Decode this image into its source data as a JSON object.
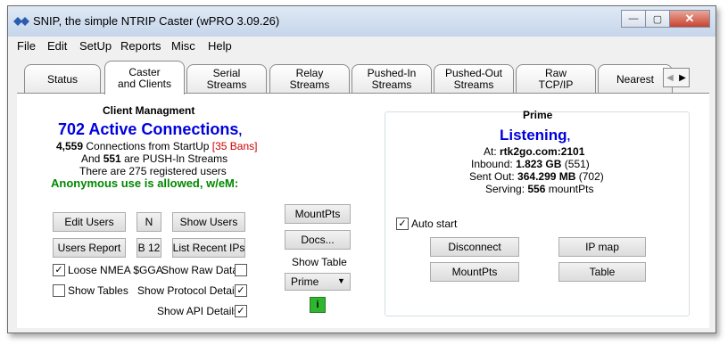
{
  "window": {
    "title": "SNIP, the simple NTRIP Caster  (wPRO 3.09.26)",
    "minimize_symbol": "—",
    "restore_symbol": "▢",
    "close_symbol": "✕"
  },
  "menu": [
    "File",
    "Edit",
    "SetUp",
    "Reports",
    "Misc",
    "Help"
  ],
  "tabs": [
    {
      "line1": "Status",
      "line2": ""
    },
    {
      "line1": "Caster",
      "line2": "and Clients"
    },
    {
      "line1": "Serial",
      "line2": "Streams"
    },
    {
      "line1": "Relay",
      "line2": "Streams"
    },
    {
      "line1": "Pushed-In",
      "line2": "Streams"
    },
    {
      "line1": "Pushed-Out",
      "line2": "Streams"
    },
    {
      "line1": "Raw",
      "line2": "TCP/IP"
    },
    {
      "line1": "Nearest",
      "line2": ""
    }
  ],
  "tab_scroll": {
    "left": "◀",
    "right": "▶"
  },
  "client": {
    "heading": "Client Managment",
    "active_count": "702",
    "active_label": "Active Connections",
    "active_suffix": ",",
    "startup_count": "4,559",
    "startup_text": "Connections from StartUp",
    "bans_open": "[",
    "bans_text": "35 Bans",
    "bans_close": "]",
    "push_prefix": "And",
    "push_count": "551",
    "push_text": "are PUSH-In Streams",
    "registered_text": "There are 275 registered users",
    "anonymous_text": "Anonymous use is allowed, w/eM:"
  },
  "buttons": {
    "edit_users": "Edit Users",
    "n": "N",
    "show_users": "Show Users",
    "users_report": "Users Report",
    "b12": "B 12",
    "list_recent_ips": "List Recent IPs",
    "mountpts_mid": "MountPts",
    "docs": "Docs...",
    "disconnect": "Disconnect",
    "ip_map": "IP map",
    "mountpts_prime": "MountPts",
    "table": "Table",
    "info": "i"
  },
  "checkboxes": {
    "loose_nmea": {
      "label": "Loose NMEA $GGA",
      "checked": true
    },
    "show_tables": {
      "label": "Show Tables",
      "checked": false
    },
    "show_raw_data": {
      "label": "Show Raw Data",
      "checked": false
    },
    "show_protocol_details": {
      "label": "Show Protocol Details",
      "checked": true
    },
    "show_api_details": {
      "label": "Show API Details",
      "checked": true
    },
    "auto_start": {
      "label": "Auto start",
      "checked": true
    }
  },
  "show_table": {
    "label": "Show Table",
    "selected": "Prime",
    "arrow": "▼"
  },
  "prime": {
    "heading": "Prime",
    "status": "Listening",
    "status_suffix": ",",
    "at_label": "At:",
    "at_value": "rtk2go.com:2101",
    "inbound_label": "Inbound:",
    "inbound_value": "1.823 GB",
    "inbound_count": "(551)",
    "sentout_label": "Sent Out:",
    "sentout_value": "364.299 MB",
    "sentout_count": "(702)",
    "serving_label": "Serving:",
    "serving_value": "556",
    "serving_suffix": "mountPts"
  },
  "colors": {
    "active_blue": "#0000dd",
    "ban_red": "#cc0000",
    "anon_green": "#008800"
  }
}
